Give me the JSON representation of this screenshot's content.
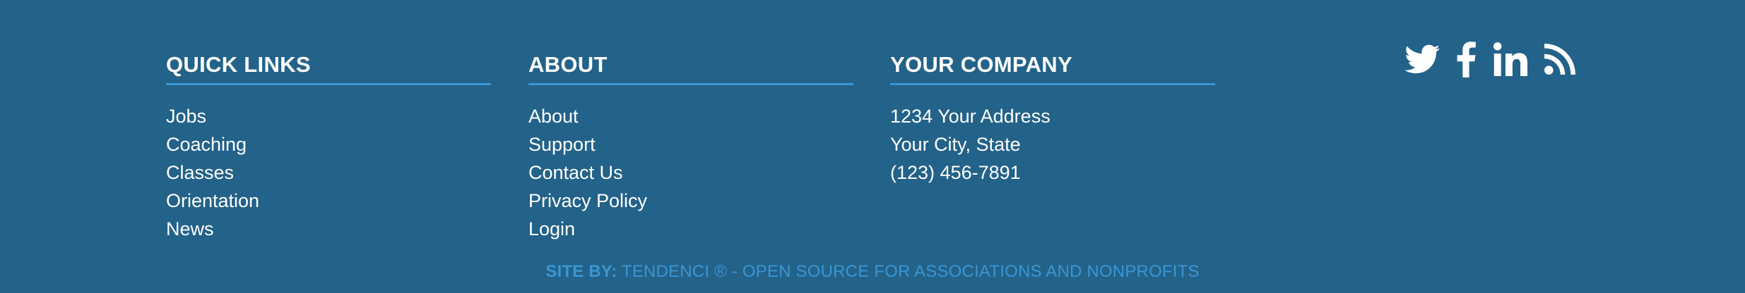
{
  "quick_links": {
    "heading": "QUICK LINKS",
    "items": [
      "Jobs",
      "Coaching",
      "Classes",
      "Orientation",
      "News"
    ]
  },
  "about": {
    "heading": "ABOUT",
    "items": [
      "About",
      "Support",
      "Contact Us",
      "Privacy Policy",
      "Login"
    ]
  },
  "company": {
    "heading": "YOUR COMPANY",
    "lines": [
      "1234 Your Address",
      "Your City, State",
      "(123) 456-7891"
    ]
  },
  "social": {
    "icons": [
      "twitter-icon",
      "facebook-icon",
      "linkedin-icon",
      "rss-icon"
    ]
  },
  "credit": {
    "prefix": "SITE BY:",
    "text": "TENDENCI ® - OPEN SOURCE FOR ASSOCIATIONS AND NONPROFITS"
  },
  "colors": {
    "background": "#236289",
    "accent": "#3a96d3",
    "text": "#ffffff"
  }
}
